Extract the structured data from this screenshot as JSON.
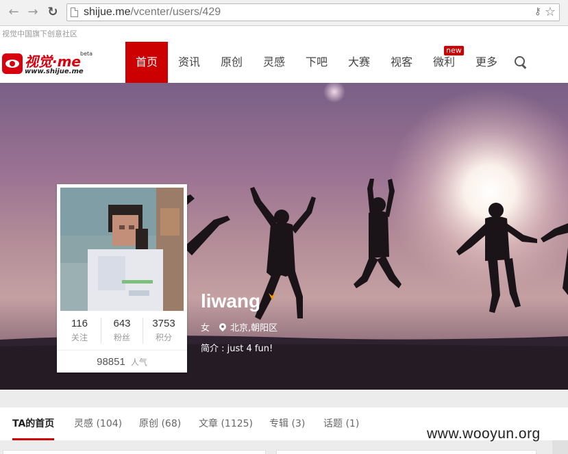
{
  "browser": {
    "url_host": "shijue.me",
    "url_path": "/vcenter/users/429"
  },
  "strip": {
    "text": "视觉中国旗下创意社区"
  },
  "logo": {
    "main": "视觉·me",
    "sub": "www.shijue.me",
    "beta": "beta"
  },
  "nav": {
    "items": [
      "首页",
      "资讯",
      "原创",
      "灵感",
      "下吧",
      "大赛",
      "视客",
      "微利",
      "更多"
    ],
    "active_index": 0,
    "badge": "new"
  },
  "profile": {
    "username": "liwang",
    "gender": "女",
    "location": "北京,朝阳区",
    "bio": "简介 : just 4 fun!",
    "stats": [
      {
        "value": "116",
        "label": "关注"
      },
      {
        "value": "643",
        "label": "粉丝"
      },
      {
        "value": "3753",
        "label": "积分"
      }
    ],
    "popularity": {
      "value": "98851",
      "label": "人气"
    }
  },
  "tabs": [
    {
      "label": "TA的首页"
    },
    {
      "label": "灵感 (104)"
    },
    {
      "label": "原创 (68)"
    },
    {
      "label": "文章 (1125)"
    },
    {
      "label": "专辑 (3)"
    },
    {
      "label": "话题 (1)"
    }
  ],
  "watermark": "www.wooyun.org",
  "colors": {
    "brand": "#cc0000",
    "verified": "#f39800"
  }
}
